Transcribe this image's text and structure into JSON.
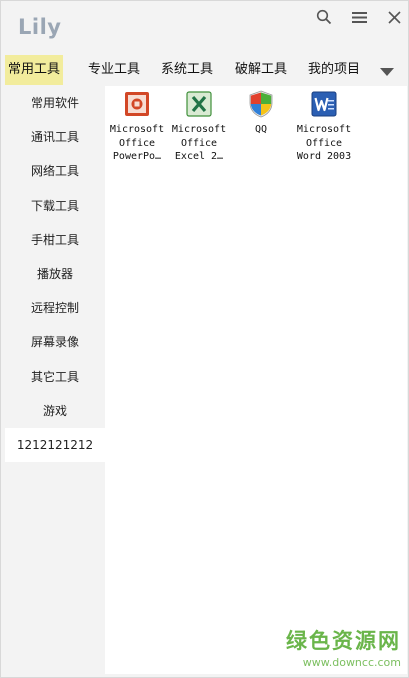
{
  "window": {
    "title": "Lily"
  },
  "titlebar": {
    "icons": [
      "search-icon",
      "hamburger-menu-icon",
      "close-icon"
    ]
  },
  "tabs": [
    {
      "label": "常用工具",
      "active": true
    },
    {
      "label": "专业工具",
      "active": false
    },
    {
      "label": "系统工具",
      "active": false
    },
    {
      "label": "破解工具",
      "active": false
    },
    {
      "label": "我的项目",
      "active": false
    }
  ],
  "tabs_more_icon": "triangle-down-icon",
  "sidebar": {
    "items": [
      {
        "label": "常用软件"
      },
      {
        "label": "通讯工具"
      },
      {
        "label": "网络工具"
      },
      {
        "label": "下载工具"
      },
      {
        "label": "手柑工具"
      },
      {
        "label": "播放器"
      },
      {
        "label": "远程控制"
      },
      {
        "label": "屏幕录像"
      },
      {
        "label": "其它工具"
      },
      {
        "label": "游戏"
      },
      {
        "label": "1212121212",
        "selected": true
      }
    ]
  },
  "apps": [
    {
      "label": "Microsoft\nOffice\nPowerPo…",
      "icon": "powerpoint-icon"
    },
    {
      "label": "Microsoft\nOffice\nExcel 2…",
      "icon": "excel-icon"
    },
    {
      "label": "QQ",
      "icon": "shield-icon"
    },
    {
      "label": "Microsoft\nOffice\nWord 2003",
      "icon": "word-icon"
    }
  ],
  "colors": {
    "active_tab": "#f2ec9c",
    "panel_bg": "#f3f3f3",
    "content_bg": "#ffffff",
    "watermark": "#6ab54a"
  },
  "watermark": {
    "text": "绿色资源网",
    "url": "www.downcc.com"
  }
}
